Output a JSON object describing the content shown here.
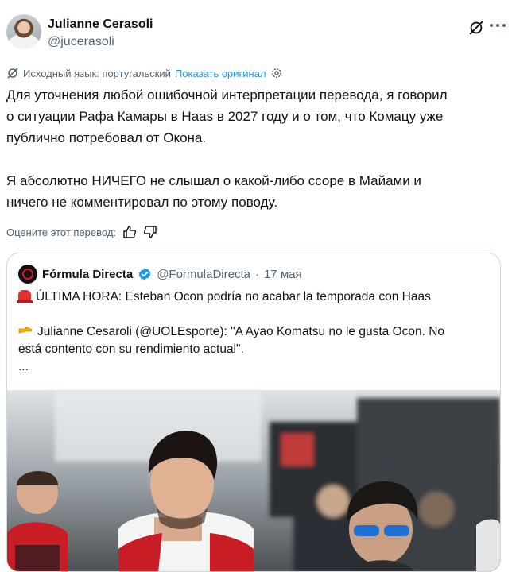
{
  "author": {
    "display_name": "Julianne Cerasoli",
    "handle": "@jucerasoli"
  },
  "translation": {
    "source_language": "Исходный язык: португальский",
    "show_original": "Показать оригинал"
  },
  "tweet": {
    "text": "Для уточнения любой ошибочной интерпретации перевода, я говорил\nо ситуации Рафа Камары в Haas в 2027 году и о том, что Комацу уже\nпублично потребовал от Окона.\n\nЯ абсолютно НИЧЕГО не слышал о какой-либо ссоре в Майами и\nничего не комментировал по этому поводу."
  },
  "rating": {
    "label": "Оцените этот перевод:"
  },
  "quote": {
    "name": "Fórmula Directa",
    "handle": "@FormulaDirecta",
    "separator": "·",
    "date": "17 мая",
    "line1": "ÚLTIMA HORA: Esteban Ocon podría no acabar la temporada con Haas",
    "line2": "Julianne Cesaroli (@UOLEsporte): \"A Ayao Komatsu no le gusta Ocon. No\nestá contento con su rendimiento actual\".\n...",
    "photo_desc": ""
  },
  "icons": {
    "grok": "grok-icon",
    "more": "more-icon",
    "translate": "translate-icon",
    "settings": "gear-icon",
    "like": "thumbs-up-icon",
    "dislike": "thumbs-down-icon",
    "verified": "verified-badge-icon",
    "siren": "siren-emoji",
    "pointing": "pointing-hand-emoji"
  },
  "colors": {
    "link": "#1d9bf0",
    "muted": "#536471",
    "text": "#0f1419",
    "border": "#cfd9de"
  }
}
